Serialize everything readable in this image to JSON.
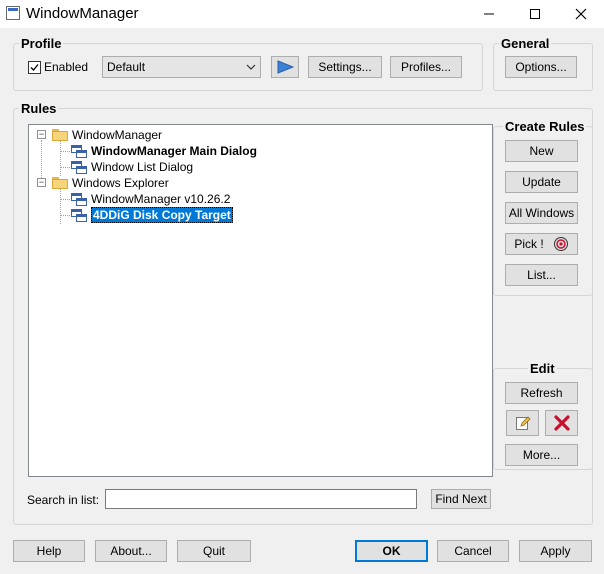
{
  "window": {
    "title": "WindowManager",
    "minimize_icon": "minimize-icon",
    "maximize_icon": "maximize-icon",
    "close_icon": "close-icon"
  },
  "profile": {
    "group_label": "Profile",
    "enabled_label": "Enabled",
    "enabled_checked": true,
    "selected_profile": "Default",
    "play_icon": "play-icon",
    "settings_label": "Settings...",
    "profiles_label": "Profiles..."
  },
  "general": {
    "group_label": "General",
    "options_label": "Options..."
  },
  "rules": {
    "group_label": "Rules",
    "tree": [
      {
        "label": "WindowManager",
        "type": "folder",
        "expanded": true,
        "children": [
          {
            "label": "WindowManager Main Dialog",
            "bold": true
          },
          {
            "label": "Window List Dialog",
            "bold": false
          }
        ]
      },
      {
        "label": "Windows Explorer",
        "type": "folder",
        "expanded": true,
        "children": [
          {
            "label": "WindowManager v10.26.2",
            "bold": false
          },
          {
            "label": "4DDiG Disk Copy Target",
            "bold": true,
            "selected": true
          }
        ]
      }
    ],
    "search_label": "Search in list:",
    "search_value": "",
    "find_next_label": "Find Next"
  },
  "create_rules": {
    "group_label": "Create Rules",
    "new_label": "New",
    "update_label": "Update",
    "all_windows_label": "All Windows",
    "pick_label": "Pick !",
    "pick_icon": "target-icon",
    "list_label": "List..."
  },
  "edit": {
    "group_label": "Edit",
    "refresh_label": "Refresh",
    "edit_icon": "pencil-icon",
    "delete_icon": "red-x-icon",
    "more_label": "More..."
  },
  "footer": {
    "help_label": "Help",
    "about_label": "About...",
    "quit_label": "Quit",
    "ok_label": "OK",
    "cancel_label": "Cancel",
    "apply_label": "Apply"
  },
  "colors": {
    "selection": "#0078d7",
    "delete_red": "#c8102e",
    "play_blue": "#3b82d6"
  }
}
